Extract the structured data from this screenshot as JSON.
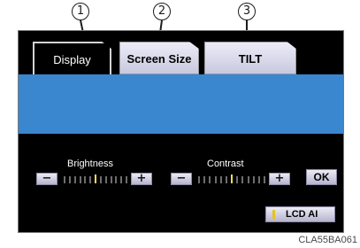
{
  "callouts": [
    "1",
    "2",
    "3"
  ],
  "tabs": {
    "display": "Display",
    "screen_size": "Screen Size",
    "tilt": "TILT"
  },
  "brightness": {
    "label": "Brightness",
    "minus": "−",
    "plus": "+",
    "level_fraction": 0.5
  },
  "contrast": {
    "label": "Contrast",
    "minus": "−",
    "plus": "+",
    "level_fraction": 0.5
  },
  "buttons": {
    "ok": "OK",
    "lcd_ai": "LCD AI"
  },
  "image_code": "CLA55BA061",
  "colors": {
    "screen_bg": "#000000",
    "blue_area": "#3a86cf",
    "indicator": "#f3dd4a"
  }
}
